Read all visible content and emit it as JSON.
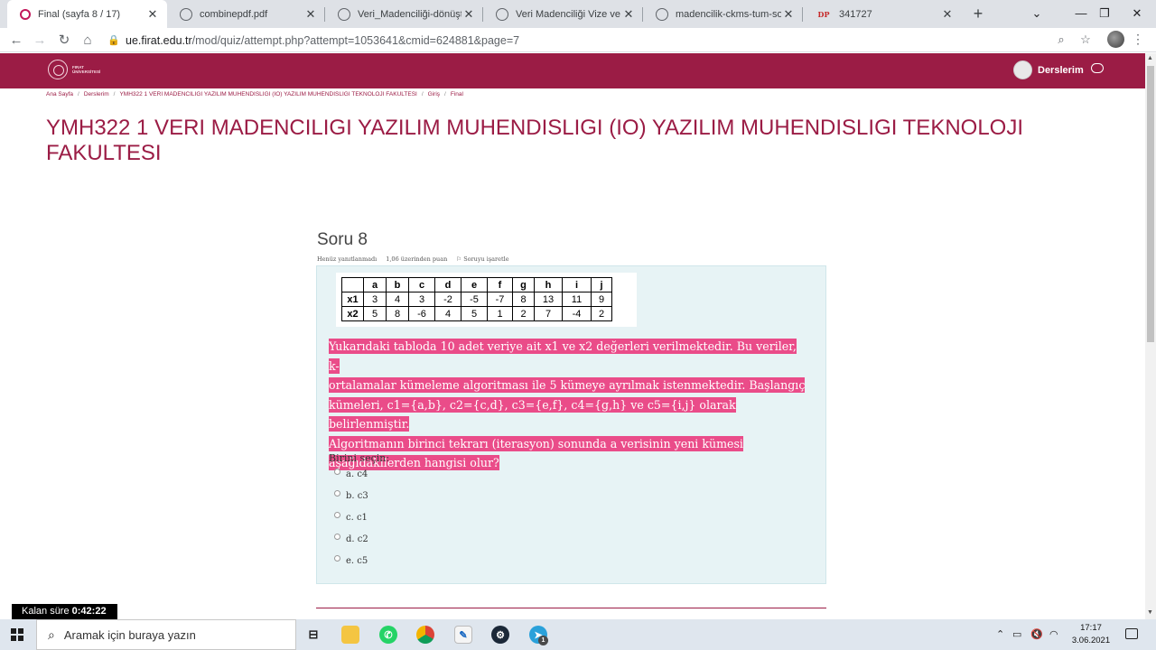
{
  "browser": {
    "tabs": [
      {
        "title": "Final (sayfa 8 / 17)",
        "favicon": "moodle-icon",
        "active": true
      },
      {
        "title": "combinepdf.pdf",
        "favicon": "globe-icon",
        "active": false
      },
      {
        "title": "Veri_Madenciliği-dönüştürü",
        "favicon": "globe-icon",
        "active": false
      },
      {
        "title": "Veri Madenciliği Vize ve Fina",
        "favicon": "globe-icon",
        "active": false
      },
      {
        "title": "madencilik-ckms-tum-sorul",
        "favicon": "globe-icon",
        "active": false
      },
      {
        "title": "341727",
        "favicon": "dp-icon",
        "favicon_text": "DP",
        "active": false
      }
    ],
    "url_host": "ue.firat.edu.tr",
    "url_path": "/mod/quiz/attempt.php?attempt=1053641&cmid=624881&page=7"
  },
  "site": {
    "logo_line1": "FIRAT",
    "logo_line2": "ÜNİVERSİTESİ",
    "user_menu_label": "Derslerim",
    "brand_color": "#9b1c45"
  },
  "breadcrumb": [
    "Ana Sayfa",
    "Derslerim",
    "YMH322 1 VERI MADENCILIGI YAZILIM MUHENDISLIGI (IO) YAZILIM MUHENDISLIGI TEKNOLOJI FAKULTESI",
    "Giriş",
    "Final"
  ],
  "page_title": "YMH322 1 VERI MADENCILIGI YAZILIM MUHENDISLIGI (IO) YAZILIM MUHENDISLIGI TEKNOLOJI FAKULTESI",
  "question": {
    "number_label": "Soru 8",
    "status": "Henüz yanıtlanmadı",
    "points": "1,06 üzerinden puan",
    "flag_label": "Soruyu işaretle",
    "table": {
      "headers": [
        "",
        "a",
        "b",
        "c",
        "d",
        "e",
        "f",
        "g",
        "h",
        "i",
        "j"
      ],
      "rows": [
        [
          "x1",
          "3",
          "4",
          "3",
          "-2",
          "-5",
          "-7",
          "8",
          "13",
          "11",
          "9"
        ],
        [
          "x2",
          "5",
          "8",
          "-6",
          "4",
          "5",
          "1",
          "2",
          "7",
          "-4",
          "2"
        ]
      ]
    },
    "text_lines": [
      "Yukarıdaki tabloda 10 adet veriye ait x1 ve x2 değerleri verilmektedir. Bu veriler, k-",
      "ortalamalar kümeleme algoritması ile 5 kümeye ayrılmak istenmektedir. Başlangıç",
      "kümeleri, c1={a,b}, c2={c,d}, c3={e,f}, c4={g,h} ve c5={i,j} olarak belirlenmiştir.",
      "Algoritmanın birinci tekrarı (iterasyon) sonunda a verisinin yeni kümesi",
      "aşağıdakilerden hangisi olur?"
    ],
    "highlight_color": "#ea4c89",
    "choose_label": "Birini seçin:",
    "options": [
      "a. c4",
      "b. c3",
      "c. c1",
      "d. c2",
      "e. c5"
    ]
  },
  "timer": {
    "label": "Kalan süre",
    "value": "0:42:22"
  },
  "taskbar": {
    "search_placeholder": "Aramak için buraya yazın",
    "time": "17:17",
    "date": "3.06.2021",
    "badge_count": "1"
  }
}
